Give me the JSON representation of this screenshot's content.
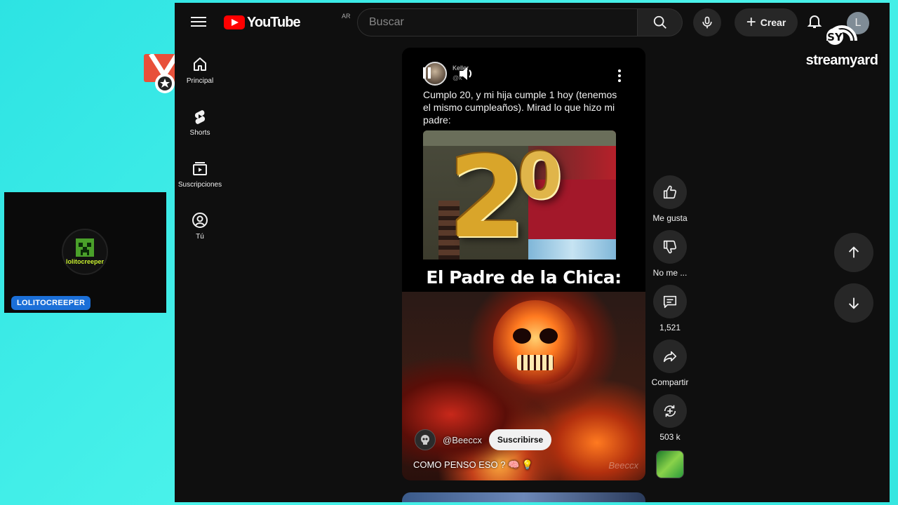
{
  "header": {
    "logo_text": "YouTube",
    "country_code": "AR",
    "search_placeholder": "Buscar",
    "create_label": "Crear",
    "avatar_initial": "L"
  },
  "sidebar": {
    "items": [
      {
        "label": "Principal",
        "icon": "home-icon"
      },
      {
        "label": "Shorts",
        "icon": "shorts-icon"
      },
      {
        "label": "Suscripciones",
        "icon": "subscriptions-icon"
      },
      {
        "label": "Tú",
        "icon": "user-icon"
      }
    ]
  },
  "short": {
    "card_name": "Keller",
    "card_handle": "@k",
    "card_text": "Cumplo 20, y mi hija cumple 1 hoy (tenemos el mismo cumpleaños). Mirad lo que hizo mi padre:",
    "balloon_number": "2",
    "balloon_zero": "0",
    "caption": "El Padre de la Chica:",
    "channel_handle": "@Beeccx",
    "subscribe_label": "Suscribirse",
    "title": "COMO PENSO ESO ? 🧠 💡",
    "watermark": "Beeccx"
  },
  "actions": {
    "like_label": "Me gusta",
    "dislike_label": "No me ...",
    "comments_count": "1,521",
    "share_label": "Compartir",
    "remix_count": "503 k"
  },
  "overlay": {
    "streamyard_label": "streamyard",
    "cam_name_tag": "LOLITOCREEPER",
    "cam_avatar_text": "lolitocreeper"
  },
  "colors": {
    "background": "#2de3e3",
    "youtube_bg": "#0f0f0f",
    "youtube_red": "#ff0000",
    "button_bg": "#272727",
    "name_tag": "#1b6fd8"
  }
}
